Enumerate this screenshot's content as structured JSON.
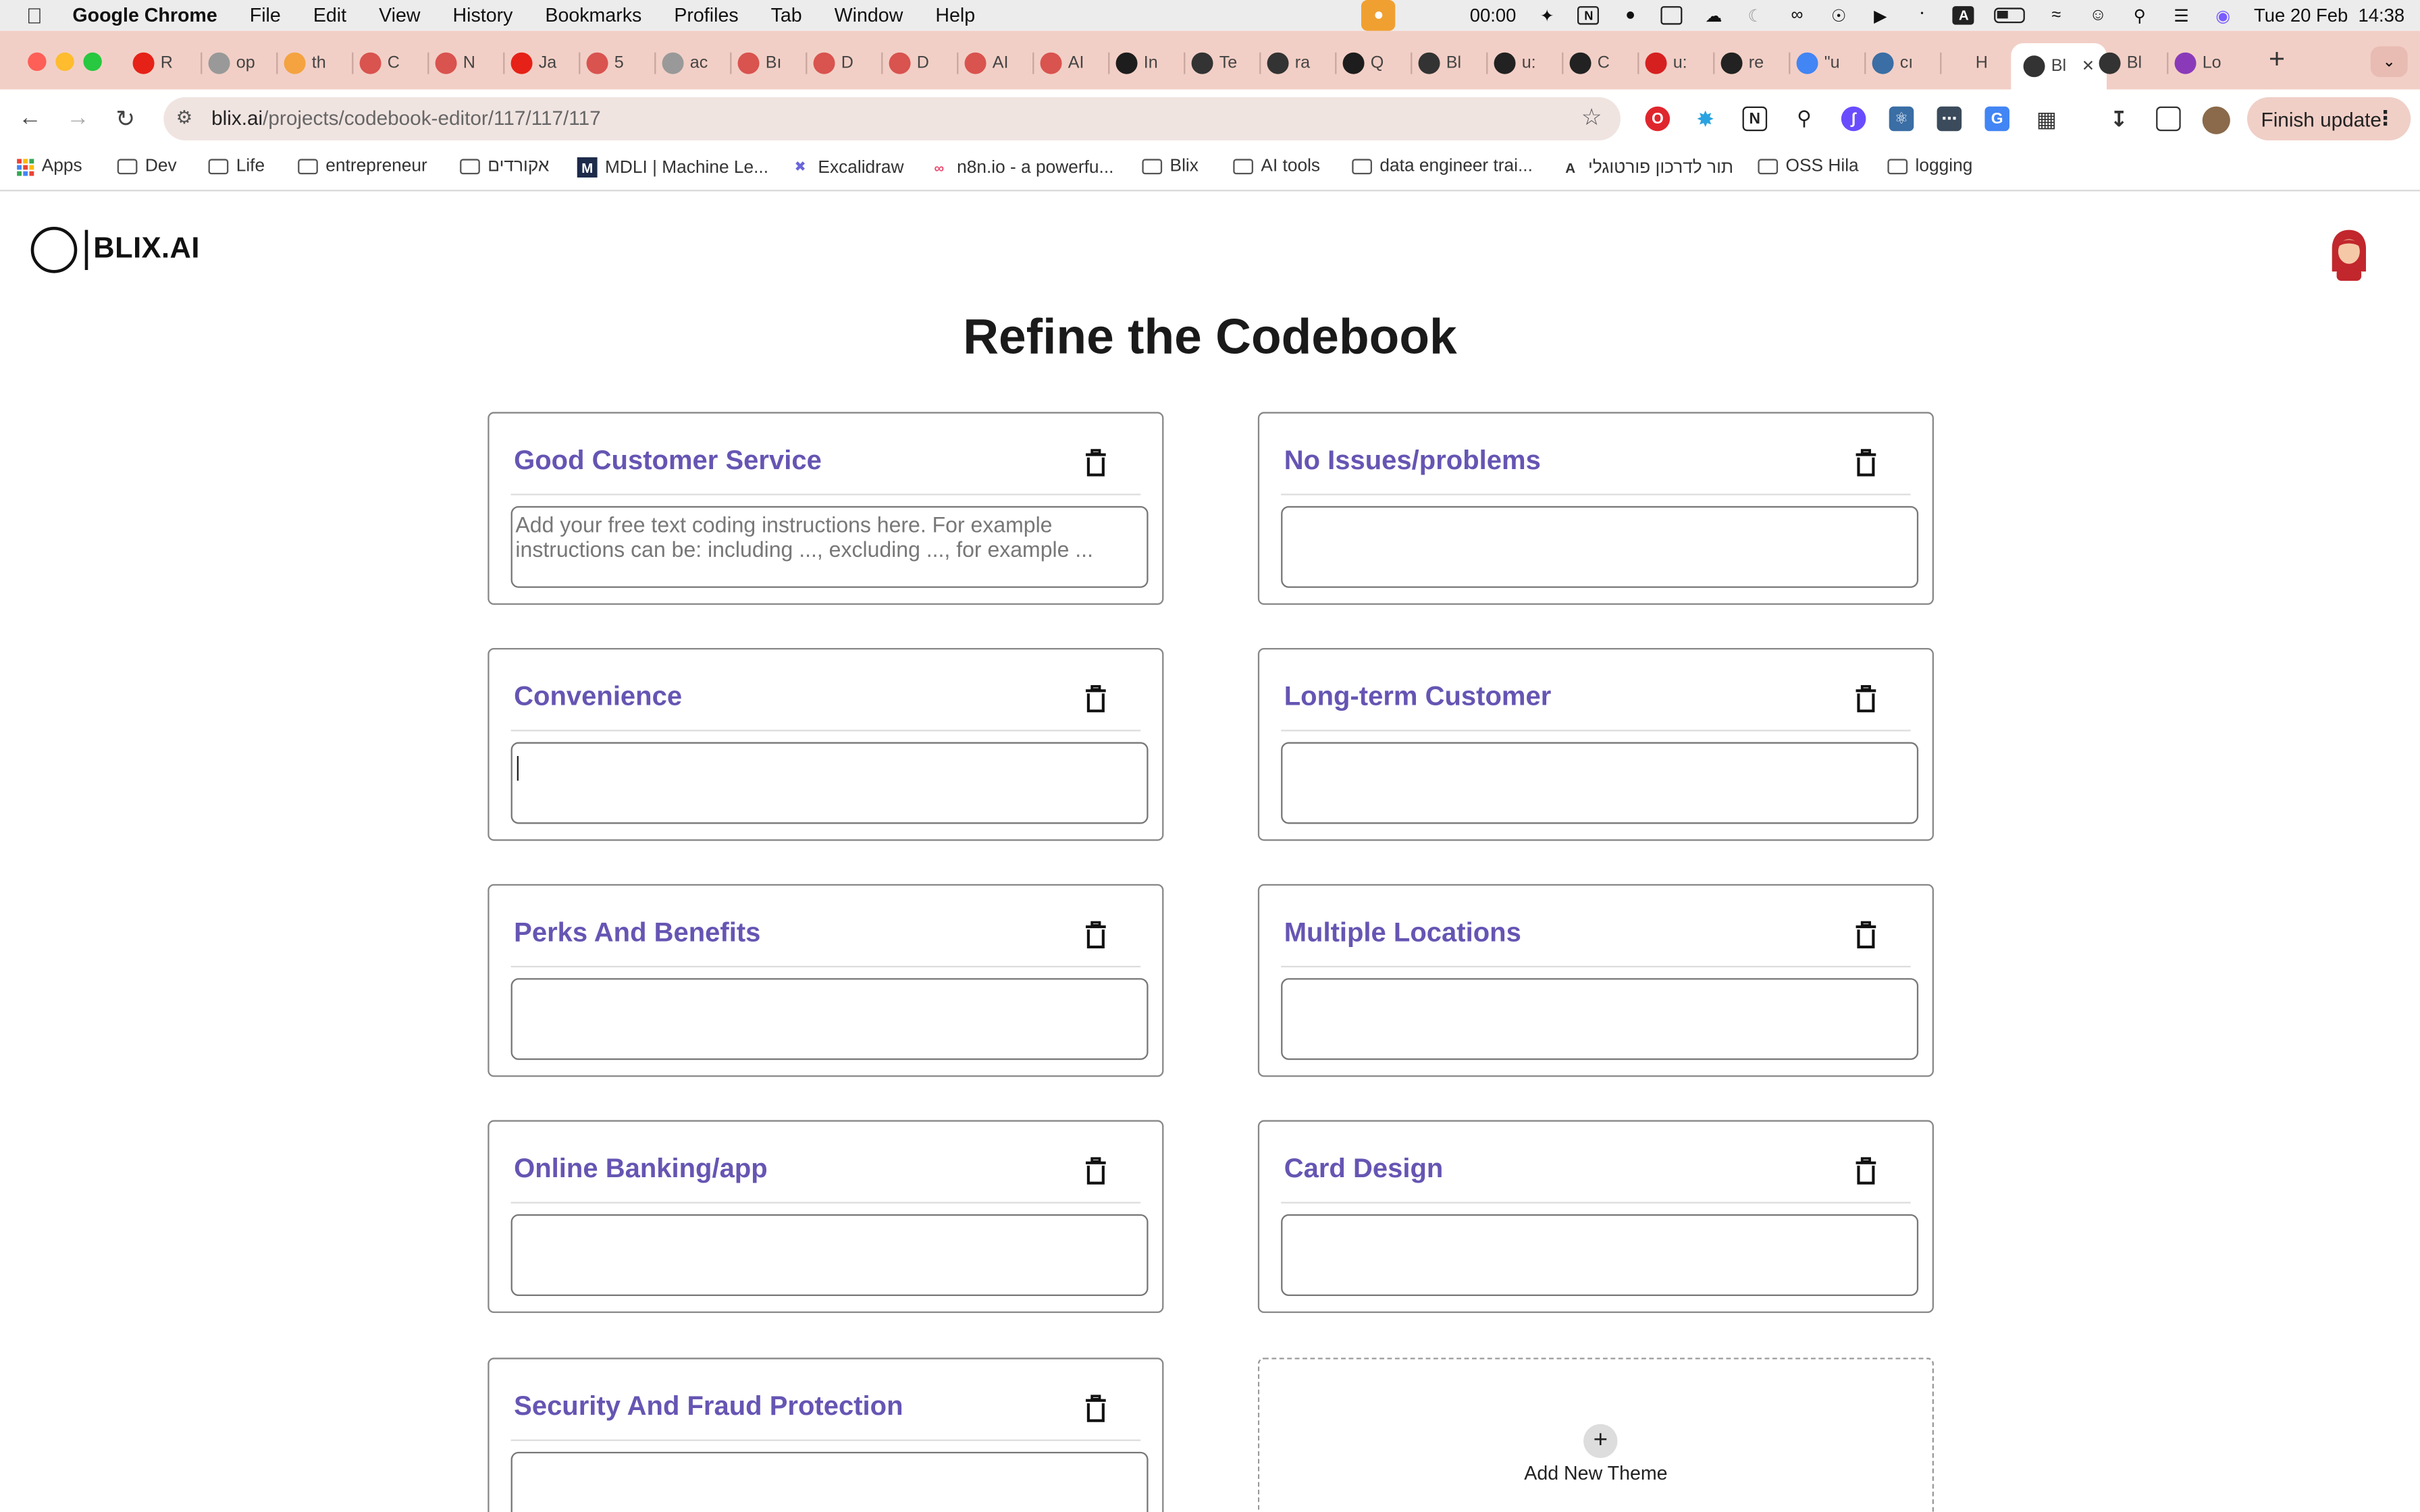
{
  "menubar": {
    "app_name": "Google Chrome",
    "items": [
      "File",
      "Edit",
      "View",
      "History",
      "Bookmarks",
      "Profiles",
      "Tab",
      "Window",
      "Help"
    ],
    "clock_timer": "00:00",
    "datetime": "Tue 20 Feb  14:38"
  },
  "tabs": {
    "items": [
      {
        "label": "R",
        "icon": "youtube-icon",
        "color": "#e62117"
      },
      {
        "label": "op",
        "icon": "google-icon",
        "color": "#999999"
      },
      {
        "label": "th",
        "icon": "notion-icon",
        "color": "#f4a340"
      },
      {
        "label": "C",
        "icon": "site-icon",
        "color": "#d9534f"
      },
      {
        "label": "N",
        "icon": "site-icon",
        "color": "#d9534f"
      },
      {
        "label": "Ja",
        "icon": "youtube-icon",
        "color": "#e62117"
      },
      {
        "label": "5",
        "icon": "site-icon",
        "color": "#d9534f"
      },
      {
        "label": "ac",
        "icon": "google-icon",
        "color": "#999999"
      },
      {
        "label": "Bı",
        "icon": "site-icon",
        "color": "#d9534f"
      },
      {
        "label": "D",
        "icon": "site-icon",
        "color": "#d9534f"
      },
      {
        "label": "D",
        "icon": "site-icon",
        "color": "#d9534f"
      },
      {
        "label": "AI",
        "icon": "site-icon",
        "color": "#d9534f"
      },
      {
        "label": "AI",
        "icon": "site-icon",
        "color": "#d9534f"
      },
      {
        "label": "In",
        "icon": "site-icon",
        "color": "#1d1d1d"
      },
      {
        "label": "Te",
        "icon": "site-icon",
        "color": "#333333"
      },
      {
        "label": "ra",
        "icon": "site-icon",
        "color": "#333333"
      },
      {
        "label": "Q",
        "icon": "site-icon",
        "color": "#1d1d1d"
      },
      {
        "label": "Bl",
        "icon": "circle-icon",
        "color": "#333333"
      },
      {
        "label": "u:",
        "icon": "github-icon",
        "color": "#222222"
      },
      {
        "label": "C",
        "icon": "site-icon",
        "color": "#222222"
      },
      {
        "label": "u:",
        "icon": "site-icon",
        "color": "#d62020"
      },
      {
        "label": "re",
        "icon": "github-icon",
        "color": "#222222"
      },
      {
        "label": "\"u",
        "icon": "google-icon",
        "color": "#4285f4"
      },
      {
        "label": "cı",
        "icon": "react-icon",
        "color": "#3a6ea5"
      },
      {
        "label": "H",
        "icon": "site-icon",
        "color": "#f2cfc6"
      },
      {
        "label": "Bl",
        "icon": "circle-icon",
        "color": "#333333"
      },
      {
        "label": "Bl",
        "icon": "circle-icon",
        "color": "#333333"
      },
      {
        "label": "Lo",
        "icon": "site-icon",
        "color": "#8a3ab9"
      }
    ],
    "new_tab": "+"
  },
  "toolbar": {
    "url_host": "blix.ai",
    "url_path": "/projects/codebook-editor/117/117/117",
    "finish_update": "Finish update"
  },
  "bookmarks": [
    {
      "label": "Apps",
      "icon": "apps-grid-icon"
    },
    {
      "label": "Dev",
      "icon": "folder-icon"
    },
    {
      "label": "Life",
      "icon": "folder-icon"
    },
    {
      "label": "entrepreneur",
      "icon": "folder-icon"
    },
    {
      "label": "אקורדים",
      "icon": "folder-icon"
    },
    {
      "label": "MDLI | Machine Le...",
      "icon": "mdli-icon"
    },
    {
      "label": "Excalidraw",
      "icon": "excalidraw-icon"
    },
    {
      "label": "n8n.io - a powerfu...",
      "icon": "n8n-icon"
    },
    {
      "label": "Blix",
      "icon": "folder-icon"
    },
    {
      "label": "AI tools",
      "icon": "folder-icon"
    },
    {
      "label": "data engineer trai...",
      "icon": "folder-icon"
    },
    {
      "label": "תור לדרכון פורטוגלי",
      "icon": "translate-icon"
    },
    {
      "label": "OSS Hila",
      "icon": "folder-icon"
    },
    {
      "label": "logging",
      "icon": "folder-icon"
    }
  ],
  "app": {
    "logo_text": "BLIX.AI",
    "page_title": "Refine the Codebook",
    "input_placeholder": "Add your free text coding instructions here. For example instructions can be: including ..., excluding ..., for example ...",
    "themes": [
      {
        "title": "Good Customer Service",
        "value": ""
      },
      {
        "title": "No Issues/problems",
        "value": ""
      },
      {
        "title": "Convenience",
        "value": ""
      },
      {
        "title": "Long-term Customer",
        "value": ""
      },
      {
        "title": "Perks And Benefits",
        "value": ""
      },
      {
        "title": "Multiple Locations",
        "value": ""
      },
      {
        "title": "Online Banking/app",
        "value": ""
      },
      {
        "title": "Card Design",
        "value": ""
      },
      {
        "title": "Security And Fraud Protection",
        "value": ""
      }
    ],
    "add_theme_label": "Add New Theme",
    "accent_color": "#6655b3"
  }
}
